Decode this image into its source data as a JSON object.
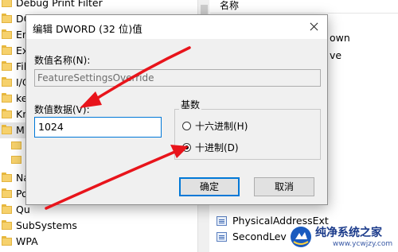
{
  "tree": {
    "items": [
      {
        "label": "Debug Print Filter"
      },
      {
        "label": "DOS Devices"
      },
      {
        "label": "En"
      },
      {
        "label": "Ex"
      },
      {
        "label": "Fil"
      },
      {
        "label": "I/C"
      },
      {
        "label": "ke"
      },
      {
        "label": "Kr"
      },
      {
        "label": "M",
        "selected": true
      },
      {
        "label": ""
      },
      {
        "label": ""
      },
      {
        "label": "Na"
      },
      {
        "label": "Po"
      },
      {
        "label": "Qu"
      },
      {
        "label": "SubSystems"
      },
      {
        "label": "WPA"
      }
    ]
  },
  "list": {
    "header": "名称",
    "row_fragments": [
      "own",
      "ve"
    ],
    "items": [
      {
        "label": "PhysicalAddressExt"
      },
      {
        "label": "SecondLev"
      }
    ]
  },
  "dialog": {
    "title": "编辑 DWORD (32 位)值",
    "value_name_label": "数值名称(N):",
    "value_name": "FeatureSettingsOverride",
    "value_data_label": "数值数据(V):",
    "value_data": "1024",
    "base_label": "基数",
    "radix_options": [
      {
        "label": "十六进制(H)",
        "checked": false
      },
      {
        "label": "十进制(D)",
        "checked": true
      }
    ],
    "ok_label": "确定",
    "cancel_label": "取消"
  },
  "annotations": {
    "arrow_color": "#e8141b"
  },
  "watermark": {
    "title": "纯净系统之家",
    "url": "www.ycwjzy.com"
  }
}
